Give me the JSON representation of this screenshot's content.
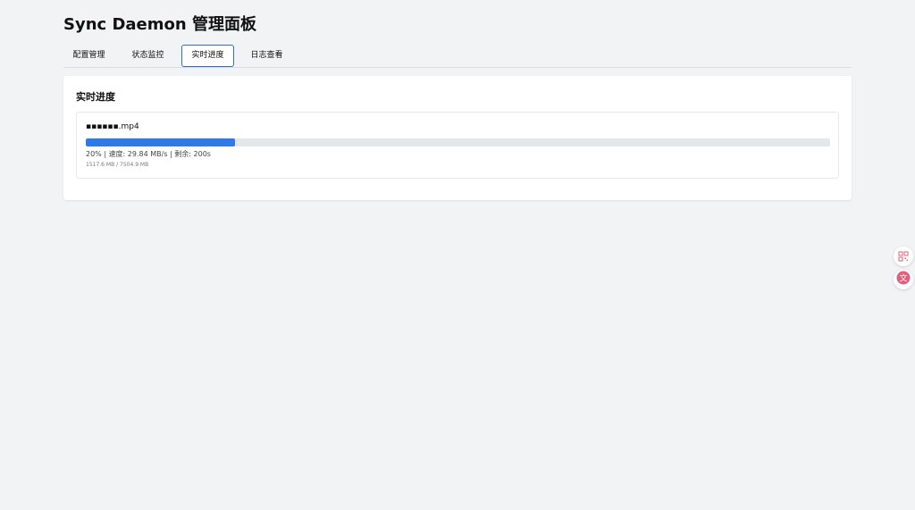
{
  "app": {
    "title": "Sync Daemon 管理面板"
  },
  "tabs": [
    {
      "label": "配置管理",
      "active": false
    },
    {
      "label": "状态监控",
      "active": false
    },
    {
      "label": "实时进度",
      "active": true
    },
    {
      "label": "日志查看",
      "active": false
    }
  ],
  "progress_section": {
    "title": "实时进度",
    "items": [
      {
        "file_name": "▪▪▪▪▪▪.mp4",
        "percent": 20,
        "stats_text": "20%  |  速度: 29.84 MB/s  |  剩余: 200s",
        "size_text": "1517.6 MB / 7504.9 MB"
      }
    ]
  },
  "side_buttons": [
    {
      "icon": "qr-grid-icon"
    },
    {
      "icon": "translate-icon"
    }
  ],
  "colors": {
    "accent": "#2f7ae8",
    "active_tab_border": "#2d6fd6",
    "background": "#f2f3f5",
    "side_icon": "#e0607e"
  }
}
